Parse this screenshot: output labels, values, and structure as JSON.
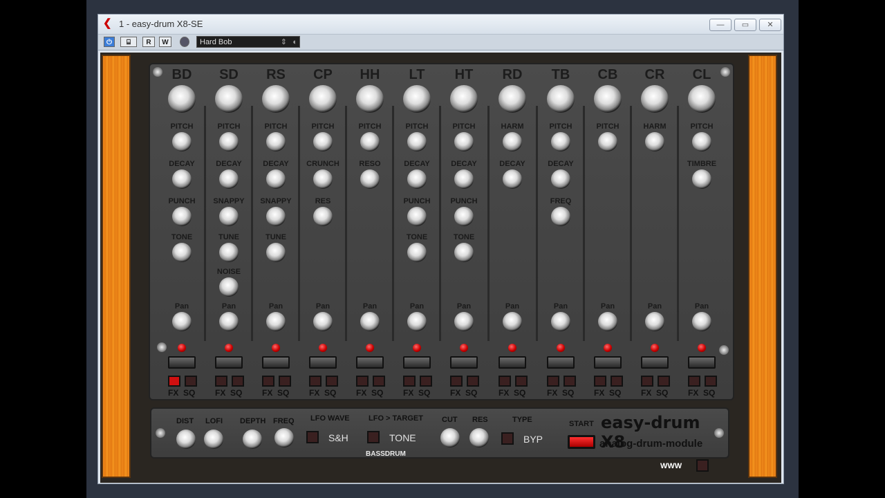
{
  "window": {
    "title": "1 - easy-drum X8-SE",
    "buttons": {
      "minimize": "—",
      "maximize": "▭",
      "close": "✕"
    }
  },
  "toolbar": {
    "power_icon": "⏻",
    "plugin_icon": "⌸",
    "read_label": "R",
    "write_label": "W",
    "preset_name": "Hard Bob",
    "arrows": "⇕",
    "extra_icon": "◐"
  },
  "channels": [
    {
      "name": "BD",
      "params": [
        "PITCH",
        "DECAY",
        "PUNCH",
        "TONE"
      ],
      "pan": "Pan",
      "fx": "FX",
      "sq": "SQ",
      "fx_on": true
    },
    {
      "name": "SD",
      "params": [
        "PITCH",
        "DECAY",
        "SNAPPY",
        "TUNE",
        "NOISE"
      ],
      "pan": "Pan",
      "fx": "FX",
      "sq": "SQ",
      "fx_on": false
    },
    {
      "name": "RS",
      "params": [
        "PITCH",
        "DECAY",
        "SNAPPY",
        "TUNE"
      ],
      "pan": "Pan",
      "fx": "FX",
      "sq": "SQ",
      "fx_on": false
    },
    {
      "name": "CP",
      "params": [
        "PITCH",
        "CRUNCH",
        "RES"
      ],
      "pan": "Pan",
      "fx": "FX",
      "sq": "SQ",
      "fx_on": false
    },
    {
      "name": "HH",
      "params": [
        "PITCH",
        "RESO"
      ],
      "pan": "Pan",
      "fx": "FX",
      "sq": "SQ",
      "fx_on": false
    },
    {
      "name": "LT",
      "params": [
        "PITCH",
        "DECAY",
        "PUNCH",
        "TONE"
      ],
      "pan": "Pan",
      "fx": "FX",
      "sq": "SQ",
      "fx_on": false
    },
    {
      "name": "HT",
      "params": [
        "PITCH",
        "DECAY",
        "PUNCH",
        "TONE"
      ],
      "pan": "Pan",
      "fx": "FX",
      "sq": "SQ",
      "fx_on": false
    },
    {
      "name": "RD",
      "params": [
        "HARM",
        "DECAY"
      ],
      "pan": "Pan",
      "fx": "FX",
      "sq": "SQ",
      "fx_on": false
    },
    {
      "name": "TB",
      "params": [
        "PITCH",
        "DECAY",
        "FREQ"
      ],
      "pan": "Pan",
      "fx": "FX",
      "sq": "SQ",
      "fx_on": false
    },
    {
      "name": "CB",
      "params": [
        "PITCH"
      ],
      "pan": "Pan",
      "fx": "FX",
      "sq": "SQ",
      "fx_on": false
    },
    {
      "name": "CR",
      "params": [
        "HARM"
      ],
      "pan": "Pan",
      "fx": "FX",
      "sq": "SQ",
      "fx_on": false
    },
    {
      "name": "CL",
      "params": [
        "PITCH",
        "TIMBRE"
      ],
      "pan": "Pan",
      "fx": "FX",
      "sq": "SQ",
      "fx_on": false
    }
  ],
  "bottom": {
    "dist": "DIST",
    "lofi": "LOFI",
    "depth": "DEPTH",
    "freq": "FREQ",
    "lfo_wave": "LFO WAVE",
    "lfo_wave_value": "S&H",
    "lfo_target": "LFO > TARGET",
    "lfo_target_value": "TONE",
    "cut": "CUT",
    "res": "RES",
    "type": "TYPE",
    "type_value": "BYP",
    "section": "BASSDRUM",
    "start": "START",
    "brand": "easy-drum X8",
    "brand_sub": "analog-drum-module",
    "www": "WWW"
  }
}
